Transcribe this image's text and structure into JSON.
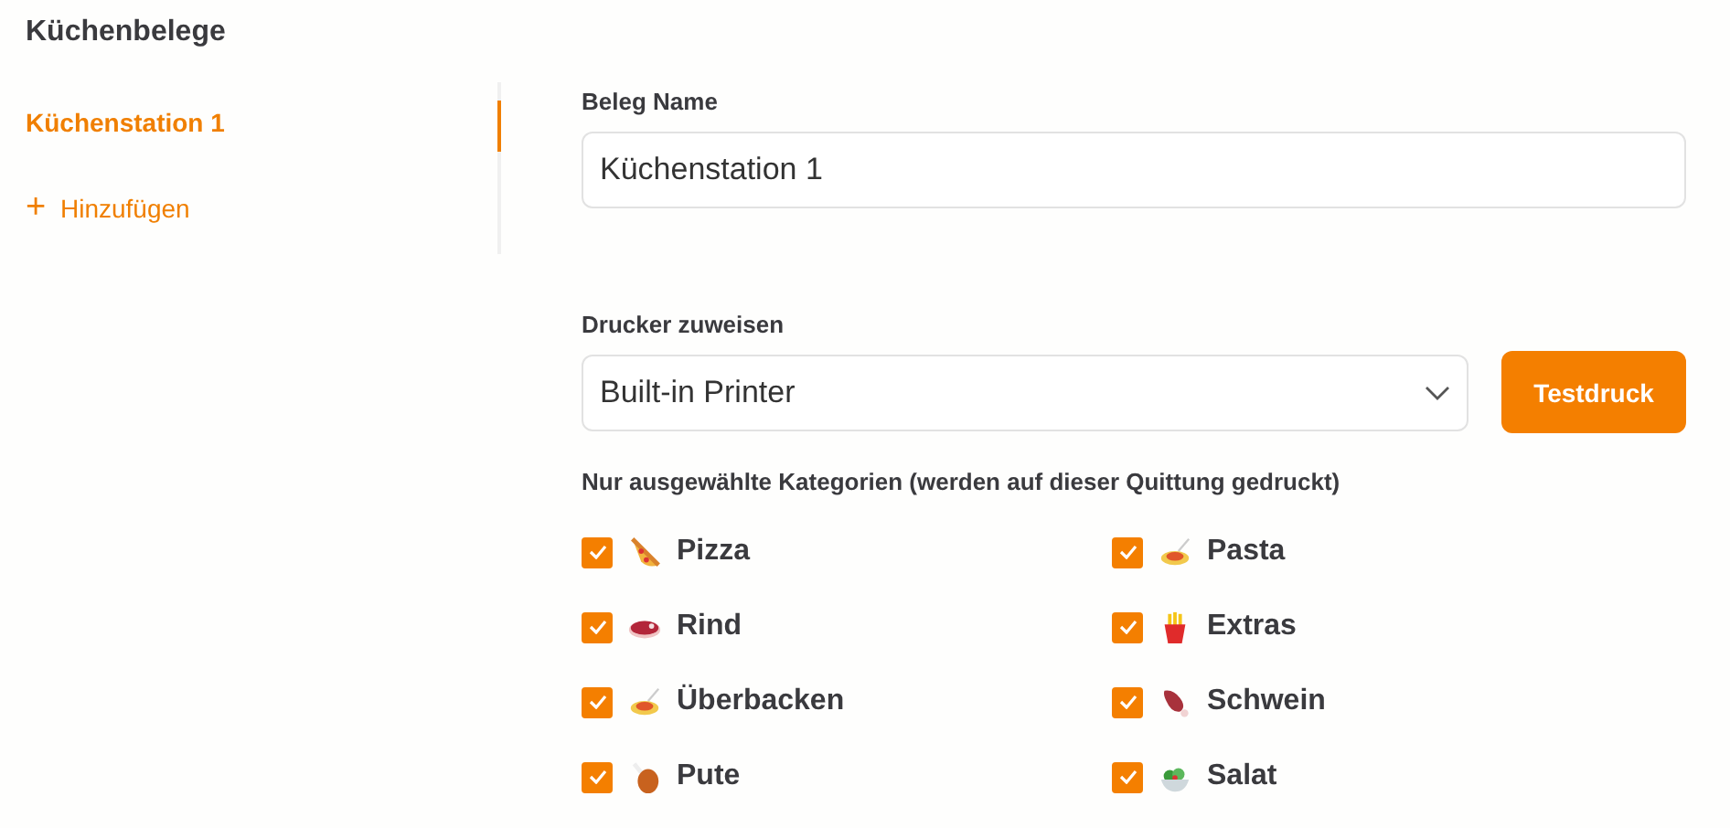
{
  "sidebar": {
    "title": "Küchenbelege",
    "items": [
      {
        "label": "Küchenstation 1",
        "selected": true
      }
    ],
    "add_label": "Hinzufügen",
    "add_icon": "+"
  },
  "form": {
    "name_label": "Beleg Name",
    "name_value": "Küchenstation 1",
    "printer_label": "Drucker zuweisen",
    "printer_value": "Built-in Printer",
    "test_button": "Testdruck",
    "categories_label": "Nur ausgewählte Kategorien (werden auf dieser Quittung gedruckt)"
  },
  "categories": [
    {
      "label": "Pizza",
      "checked": true
    },
    {
      "label": "Pasta",
      "checked": true
    },
    {
      "label": "Rind",
      "checked": true
    },
    {
      "label": "Extras",
      "checked": true
    },
    {
      "label": "Überbacken",
      "checked": true
    },
    {
      "label": "Schwein",
      "checked": true
    },
    {
      "label": "Pute",
      "checked": true
    },
    {
      "label": "Salat",
      "checked": true
    }
  ]
}
